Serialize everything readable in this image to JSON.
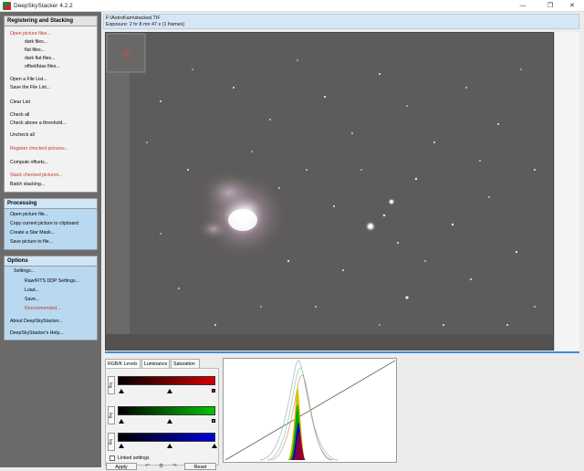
{
  "window": {
    "title": "DeepSkyStacker 4.2.2"
  },
  "sidebar": {
    "registering": {
      "title": "Registering and Stacking",
      "items": [
        {
          "label": "Open picture files...",
          "color": "red"
        },
        {
          "label": "dark files...",
          "color": "black"
        },
        {
          "label": "flat files...",
          "color": "black"
        },
        {
          "label": "dark flat files...",
          "color": "black"
        },
        {
          "label": "offset/bias files...",
          "color": "black"
        },
        {
          "label": "Open a File List...",
          "color": "black"
        },
        {
          "label": "Save the File List...",
          "color": "black"
        },
        {
          "label": "Clear List",
          "color": "black"
        },
        {
          "label": "Check all",
          "color": "black"
        },
        {
          "label": "Check above a threshold...",
          "color": "black"
        },
        {
          "label": "Uncheck all",
          "color": "black"
        },
        {
          "label": "Register checked pictures...",
          "color": "red"
        },
        {
          "label": "Compute offsets...",
          "color": "black"
        },
        {
          "label": "Stack checked pictures...",
          "color": "red"
        },
        {
          "label": "Batch stacking...",
          "color": "black"
        }
      ]
    },
    "processing": {
      "title": "Processing",
      "items": [
        {
          "label": "Open picture file..."
        },
        {
          "label": "Copy current picture to clipboard"
        },
        {
          "label": "Create a Star Mask..."
        },
        {
          "label": "Save picture to file..."
        }
      ]
    },
    "options": {
      "title": "Options",
      "items": [
        {
          "label": "Settings..."
        },
        {
          "label": "Raw/FITS DDP Settings..."
        },
        {
          "label": "Load..."
        },
        {
          "label": "Save..."
        },
        {
          "label": "Recommended..."
        },
        {
          "label": "About DeepSkyStacker..."
        },
        {
          "label": "DeepSkyStacker's Help..."
        }
      ]
    }
  },
  "info": {
    "path": "F:\\AstroKam\\stacked.TIF",
    "exposure": "Exposure: 2 hr 8 mn 47 s (1 frames)"
  },
  "levels": {
    "tabs": [
      "RGB/K Levels",
      "Luminance",
      "Saturation"
    ],
    "log_label": "log",
    "linked_label": "Linked settings",
    "apply_label": "Apply",
    "reset_label": "Reset",
    "colors": {
      "red": "#d40000",
      "green": "#00c800",
      "blue": "#0000e0"
    }
  }
}
